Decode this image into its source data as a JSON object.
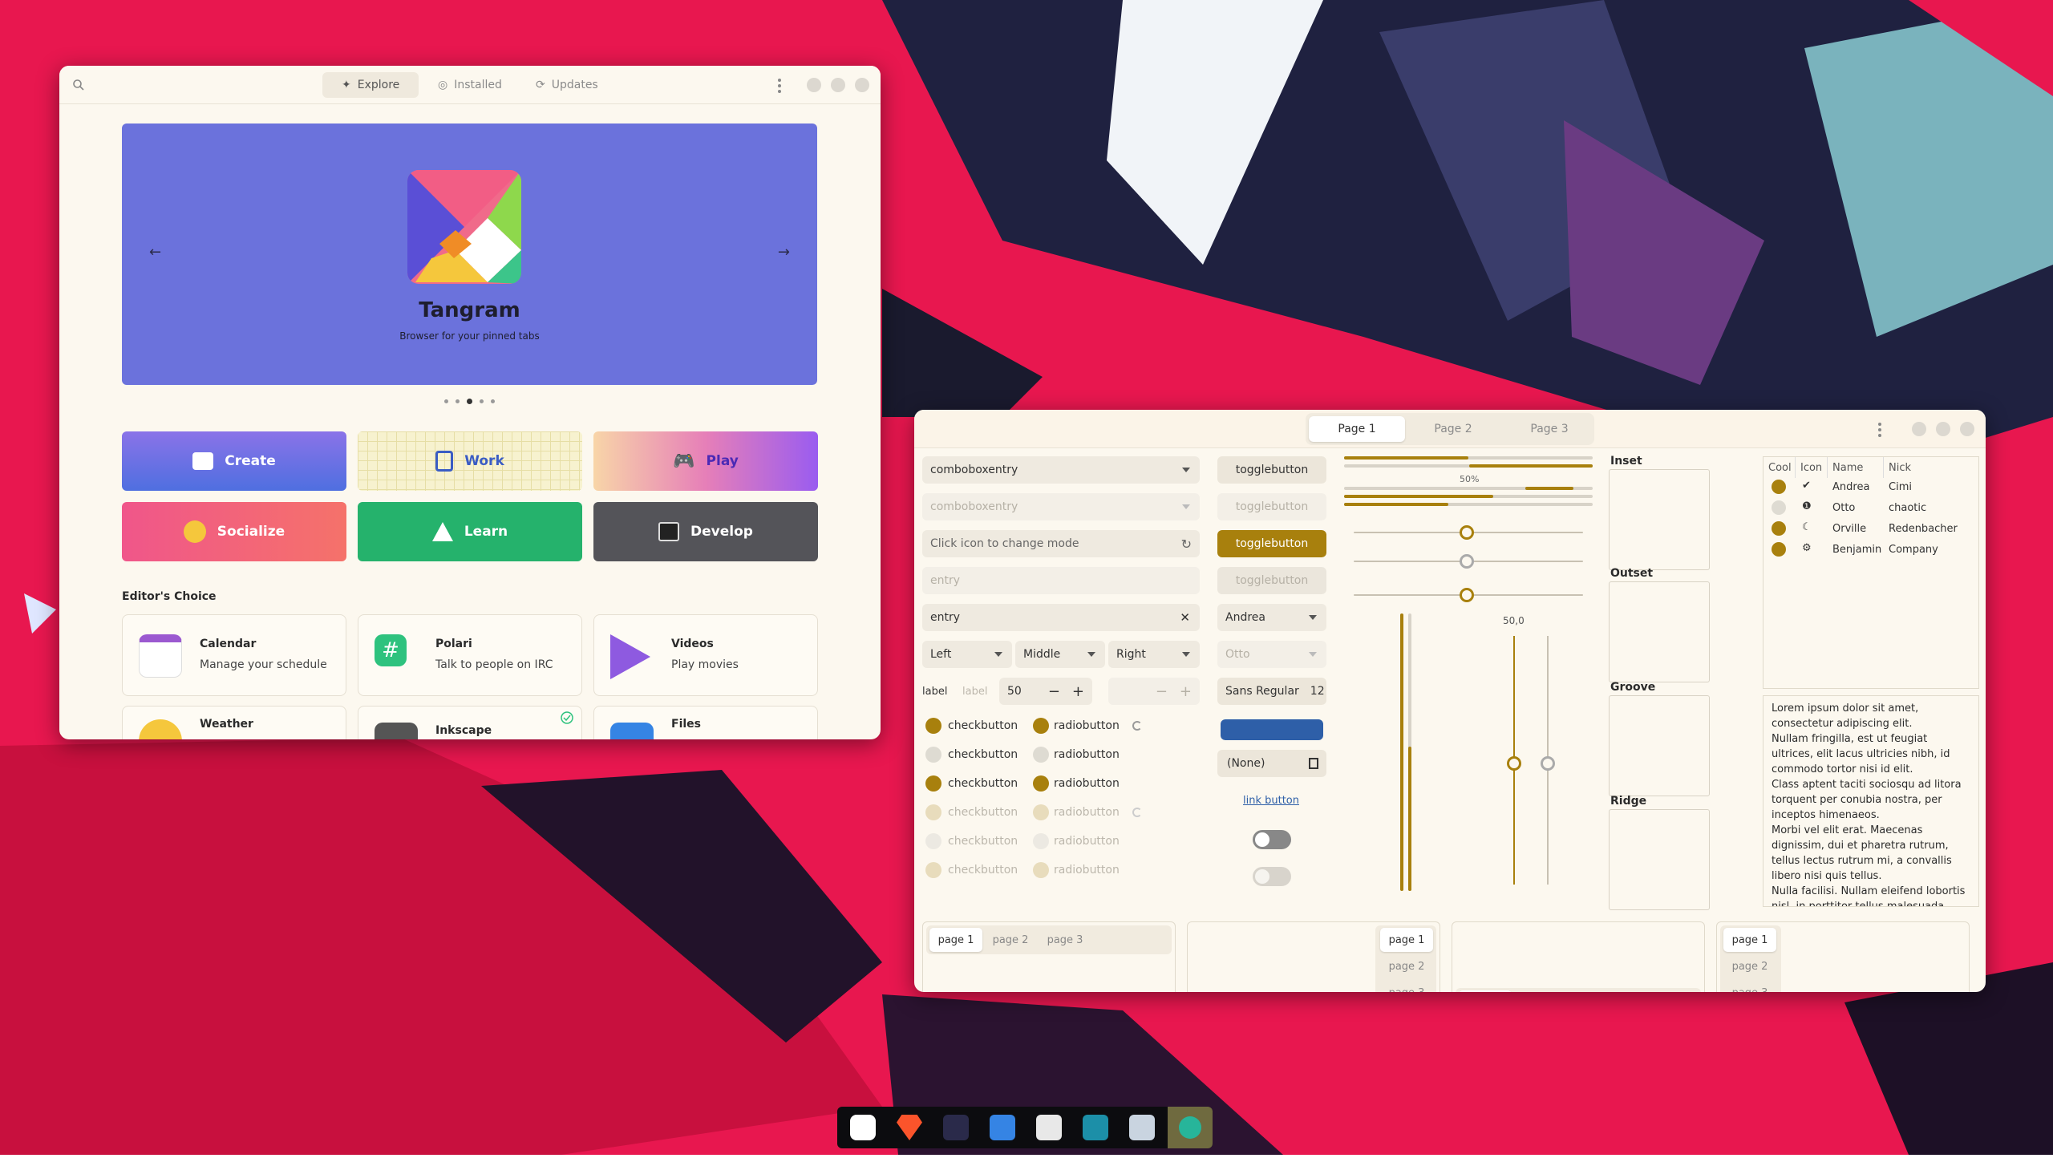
{
  "colors": {
    "accent": "#a8800d",
    "wallpaper": "#e8174f",
    "banner": "#6b72dc",
    "window_bg": "#fcf8ef"
  },
  "software": {
    "tabs": [
      {
        "label": "Explore",
        "icon": "compass-icon"
      },
      {
        "label": "Installed",
        "icon": "check-circle-icon"
      },
      {
        "label": "Updates",
        "icon": "refresh-icon"
      }
    ],
    "banner": {
      "title": "Tangram",
      "subtitle": "Browser for your pinned tabs",
      "prev": "←",
      "next": "→"
    },
    "categories": [
      {
        "label": "Create",
        "icon": "create-icon"
      },
      {
        "label": "Work",
        "icon": "work-icon"
      },
      {
        "label": "Play",
        "icon": "gamepad-icon"
      },
      {
        "label": "Socialize",
        "icon": "emoji-icon"
      },
      {
        "label": "Learn",
        "icon": "learn-icon"
      },
      {
        "label": "Develop",
        "icon": "terminal-icon"
      }
    ],
    "section_title": "Editor's Choice",
    "apps": [
      {
        "name": "Calendar",
        "desc": "Manage your schedule"
      },
      {
        "name": "Polari",
        "desc": "Talk to people on IRC"
      },
      {
        "name": "Videos",
        "desc": "Play movies"
      },
      {
        "name": "Weather",
        "desc": ""
      },
      {
        "name": "Inkscape",
        "desc": ""
      },
      {
        "name": "Files",
        "desc": ""
      }
    ]
  },
  "widgets": {
    "tabs": [
      "Page 1",
      "Page 2",
      "Page 3"
    ],
    "combo1": "comboboxentry",
    "combo2": "comboboxentry",
    "mode_entry_placeholder": "Click icon to change mode",
    "entry_placeholder": "entry",
    "entry_value": "entry",
    "combos3": [
      "Left",
      "Middle",
      "Right"
    ],
    "label1": "label",
    "label2": "label",
    "spin_value": "50",
    "checks": [
      "checkbutton",
      "checkbutton",
      "checkbutton",
      "checkbutton",
      "checkbutton",
      "checkbutton"
    ],
    "radios": [
      "radiobutton",
      "radiobutton",
      "radiobutton",
      "radiobutton",
      "radiobutton",
      "radiobutton"
    ],
    "toggles": [
      "togglebutton",
      "togglebutton",
      "togglebutton",
      "togglebutton"
    ],
    "combo_name": "Andrea",
    "combo_name_dis": "Otto",
    "font_name": "Sans Regular",
    "font_size": "12",
    "file_none": "(None)",
    "link": "link button",
    "progress_label": "50%",
    "scale_value": "50,0",
    "frames": [
      "Inset",
      "Outset",
      "Groove",
      "Ridge"
    ],
    "tree_headers": [
      "Cool",
      "Icon",
      "Name",
      "Nick"
    ],
    "tree_rows": [
      {
        "name": "Andrea",
        "nick": "Cimi"
      },
      {
        "name": "Otto",
        "nick": "chaotic"
      },
      {
        "name": "Orville",
        "nick": "Redenbacher"
      },
      {
        "name": "Benjamin",
        "nick": "Company"
      }
    ],
    "lorem": "Lorem ipsum dolor sit amet, consectetur adipiscing elit.\nNullam fringilla, est ut feugiat ultrices, elit lacus ultricies nibh, id commodo tortor nisi id elit.\nClass aptent taciti sociosqu ad litora torquent per conubia nostra, per inceptos himenaeos.\nMorbi vel elit erat. Maecenas dignissim, dui et pharetra rutrum, tellus lectus rutrum mi, a convallis libero nisi quis tellus.\nNulla facilisi. Nullam eleifend lobortis nisl, in porttitor tellus malesuada vitae.",
    "nb_tabs": [
      "page 1",
      "page 2",
      "page 3"
    ]
  },
  "dock_apps": [
    "software-icon",
    "brave-icon",
    "sublime-icon",
    "files-icon",
    "store-icon",
    "screenshot-icon",
    "image-viewer-icon",
    "settings-icon"
  ]
}
